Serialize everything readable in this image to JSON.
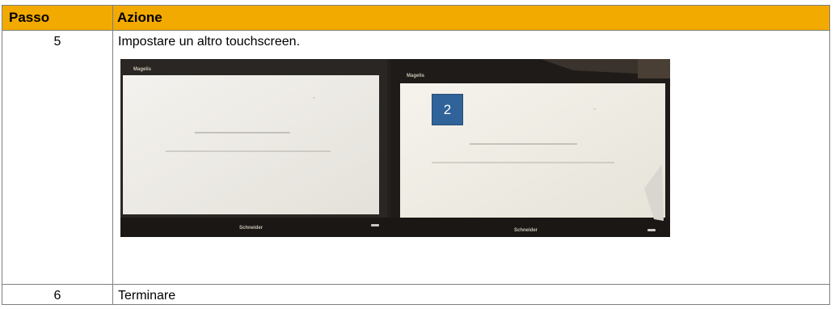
{
  "table": {
    "headers": {
      "step": "Passo",
      "action": "Azione"
    },
    "rows": [
      {
        "step": "5",
        "action": "Impostare un altro touchscreen."
      },
      {
        "step": "6",
        "action": "Terminare"
      }
    ]
  },
  "photo": {
    "marker_label": "2",
    "brand_left": "Schneider",
    "brand_right": "Schneider",
    "brand_colors": {
      "screen": "#f3f1ec",
      "bezel": "#1f1c1a",
      "marker": "#2f6399"
    }
  }
}
